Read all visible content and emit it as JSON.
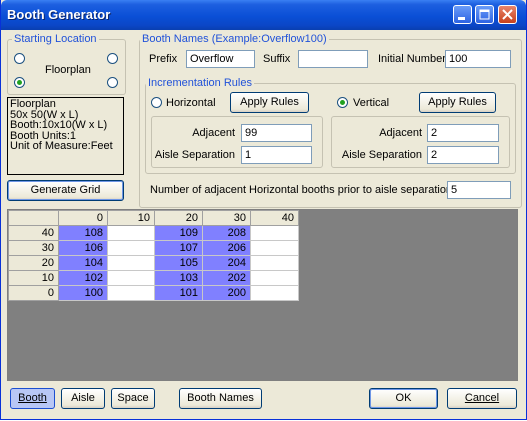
{
  "window": {
    "title": "Booth Generator"
  },
  "starting_location": {
    "title": "Starting Location",
    "center_label": "Floorplan",
    "selected": "bottom-left"
  },
  "info": {
    "lines": [
      "Floorplan",
      "50x 50(W x L)",
      "Booth:10x10(W x L)",
      "Booth Units:1",
      "Unit of Measure:Feet"
    ]
  },
  "generate_button": "Generate Grid",
  "booth_names": {
    "title": "Booth Names (Example:Overflow100)",
    "prefix_label": "Prefix",
    "prefix_value": "Overflow",
    "suffix_label": "Suffix",
    "suffix_value": "",
    "initial_label": "Initial Number",
    "initial_value": "100"
  },
  "increment": {
    "title": "Incrementation Rules",
    "horizontal": {
      "label": "Horizontal",
      "selected": false,
      "apply_label": "Apply Rules",
      "adjacent_label": "Adjacent",
      "adjacent_value": "99",
      "aisle_label": "Aisle Separation",
      "aisle_value": "1"
    },
    "vertical": {
      "label": "Vertical",
      "selected": true,
      "apply_label": "Apply Rules",
      "adjacent_label": "Adjacent",
      "adjacent_value": "2",
      "aisle_label": "Aisle Separation",
      "aisle_value": "2"
    }
  },
  "adjacent_prior": {
    "label": "Number of adjacent Horizontal booths prior to aisle separation:",
    "value": "5"
  },
  "grid": {
    "columns": [
      "",
      "0",
      "10",
      "20",
      "30",
      "40"
    ],
    "rows": [
      {
        "label": "40",
        "cells": [
          "108",
          "",
          "109",
          "208",
          ""
        ]
      },
      {
        "label": "30",
        "cells": [
          "106",
          "",
          "107",
          "206",
          ""
        ]
      },
      {
        "label": "20",
        "cells": [
          "104",
          "",
          "105",
          "204",
          ""
        ]
      },
      {
        "label": "10",
        "cells": [
          "102",
          "",
          "103",
          "202",
          ""
        ]
      },
      {
        "label": "0",
        "cells": [
          "100",
          "",
          "101",
          "200",
          ""
        ]
      }
    ],
    "highlight_color": "#8080ff"
  },
  "bottom": {
    "booth": "Booth",
    "aisle": "Aisle",
    "space": "Space",
    "booth_names": "Booth Names",
    "ok": "OK",
    "cancel": "Cancel"
  }
}
